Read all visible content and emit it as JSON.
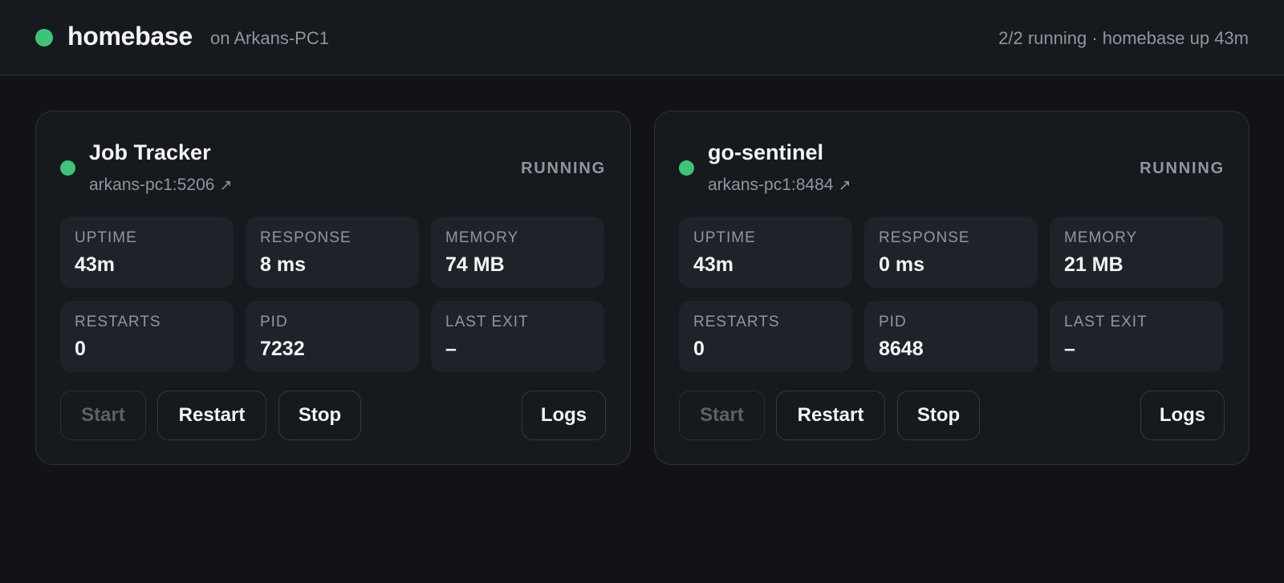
{
  "header": {
    "title": "homebase",
    "host": "on Arkans-PC1",
    "status": "2/2 running · homebase up 43m",
    "status_color": "#3ec479"
  },
  "services": [
    {
      "name": "Job Tracker",
      "link": "arkans-pc1:5206",
      "link_icon": "external-link-arrow",
      "status": "RUNNING",
      "stats": [
        {
          "label": "UPTIME",
          "value": "43m"
        },
        {
          "label": "RESPONSE",
          "value": "8 ms"
        },
        {
          "label": "MEMORY",
          "value": "74 MB"
        },
        {
          "label": "RESTARTS",
          "value": "0"
        },
        {
          "label": "PID",
          "value": "7232"
        },
        {
          "label": "LAST EXIT",
          "value": "–"
        }
      ],
      "buttons": {
        "start": "Start",
        "restart": "Restart",
        "stop": "Stop",
        "logs": "Logs"
      }
    },
    {
      "name": "go-sentinel",
      "link": "arkans-pc1:8484",
      "link_icon": "external-link-arrow",
      "status": "RUNNING",
      "stats": [
        {
          "label": "UPTIME",
          "value": "43m"
        },
        {
          "label": "RESPONSE",
          "value": "0 ms"
        },
        {
          "label": "MEMORY",
          "value": "21 MB"
        },
        {
          "label": "RESTARTS",
          "value": "0"
        },
        {
          "label": "PID",
          "value": "8648"
        },
        {
          "label": "LAST EXIT",
          "value": "–"
        }
      ],
      "buttons": {
        "start": "Start",
        "restart": "Restart",
        "stop": "Stop",
        "logs": "Logs"
      }
    }
  ]
}
